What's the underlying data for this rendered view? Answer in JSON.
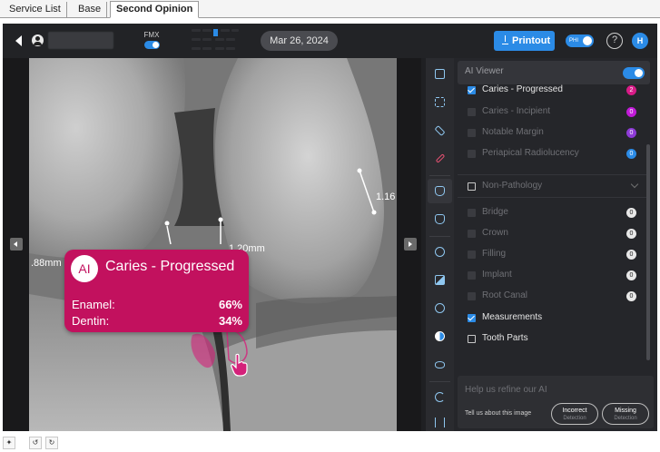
{
  "tabs": [
    {
      "label": "Service List"
    },
    {
      "label": "Base"
    },
    {
      "label": "Second Opinion"
    }
  ],
  "header": {
    "fmx_label": "FMX",
    "date": "Mar 26, 2024",
    "printout_label": "Printout",
    "phi_label": "PHI",
    "help_glyph": "?",
    "avatar_initial": "H"
  },
  "popup": {
    "badge": "AI",
    "title": "Caries - Progressed",
    "rows": [
      {
        "label": "Enamel:",
        "value": "66%"
      },
      {
        "label": "Dentin:",
        "value": "34%"
      }
    ]
  },
  "measurements": [
    {
      "text": "1.16"
    },
    {
      "text": "1.20mm"
    },
    {
      "text": ".88mm"
    }
  ],
  "panel": {
    "ai_viewer_label": "AI Viewer",
    "findings": [
      {
        "label": "Caries - Progressed",
        "count": "2",
        "color": "#d81b87",
        "checked": true
      },
      {
        "label": "Caries - Incipient",
        "count": "0",
        "color": "#c11bd8",
        "checked": false
      },
      {
        "label": "Notable Margin",
        "count": "0",
        "color": "#8e3bd6",
        "checked": false
      },
      {
        "label": "Periapical Radiolucency",
        "count": "0",
        "color": "#2b8be6",
        "checked": false
      }
    ],
    "non_pathology_label": "Non-Pathology",
    "restorations": [
      {
        "label": "Bridge",
        "count": "0"
      },
      {
        "label": "Crown",
        "count": "0"
      },
      {
        "label": "Filling",
        "count": "0"
      },
      {
        "label": "Implant",
        "count": "0"
      },
      {
        "label": "Root Canal",
        "count": "0"
      }
    ],
    "measurements_label": "Measurements",
    "tooth_parts_label": "Tooth Parts",
    "feedback": {
      "title": "Help us refine our AI",
      "subtitle": "Tell us about this image",
      "incorrect_label": "Incorrect",
      "incorrect_sub": "Detection",
      "missing_label": "Missing",
      "missing_sub": "Detection"
    }
  },
  "rail_icons": [
    "layout-icon",
    "crosshair-icon",
    "ruler-icon",
    "pen-icon",
    "tooth-icon",
    "tooth-outline-icon",
    "brightness-icon",
    "contrast-gradient-icon",
    "zoom-icon",
    "invert-icon",
    "eye-icon",
    "rotate-icon",
    "flip-icon"
  ],
  "colors": {
    "accent": "#2b8be6",
    "caries": "#c2115e",
    "panel_bg": "#25262a"
  }
}
